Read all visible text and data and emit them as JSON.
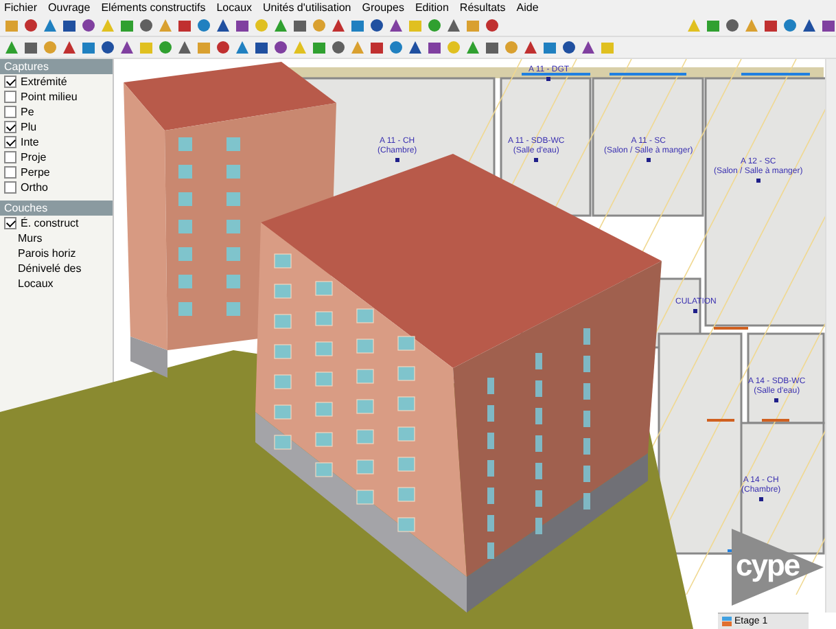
{
  "menu": [
    "Fichier",
    "Ouvrage",
    "Eléments constructifs",
    "Locaux",
    "Unités d'utilisation",
    "Groupes",
    "Edition",
    "Résultats",
    "Aide"
  ],
  "captures": {
    "title": "Captures",
    "items": [
      {
        "label": "Extrémité",
        "checked": true
      },
      {
        "label": "Point milieu",
        "checked": false
      },
      {
        "label": "Pe",
        "checked": false
      },
      {
        "label": "Plu",
        "checked": true
      },
      {
        "label": "Inte",
        "checked": true
      },
      {
        "label": "Proje",
        "checked": false
      },
      {
        "label": "Perpe",
        "checked": false
      },
      {
        "label": "Ortho",
        "checked": false
      }
    ]
  },
  "couches": {
    "title": "Couches",
    "items": [
      {
        "kind": "check",
        "label": "É. construct",
        "checked": true
      },
      {
        "kind": "plain",
        "label": "Murs"
      },
      {
        "kind": "plain",
        "label": "Parois horiz"
      },
      {
        "kind": "plain",
        "label": "Dénivelé des"
      },
      {
        "kind": "plain",
        "label": "Locaux"
      }
    ]
  },
  "plan": {
    "rooms": [
      {
        "name": "A 11 - DGT"
      },
      {
        "name": "A 11 - CH",
        "use": "(Chambre)"
      },
      {
        "name": "A 11 - SDB-WC",
        "use": "(Salle d'eau)"
      },
      {
        "name": "A 11 - SC",
        "use": "(Salon / Salle à manger)"
      },
      {
        "name": "A 12 - SC",
        "use": "(Salon / Salle à manger)"
      },
      {
        "name": "CULATION"
      },
      {
        "name": "A 14 - SDB-WC",
        "use": "(Salle d'eau)"
      },
      {
        "name": "A 14 - CH",
        "use": "(Chambre)"
      }
    ]
  },
  "floor_tab": "Etage 1",
  "logo": "cype"
}
